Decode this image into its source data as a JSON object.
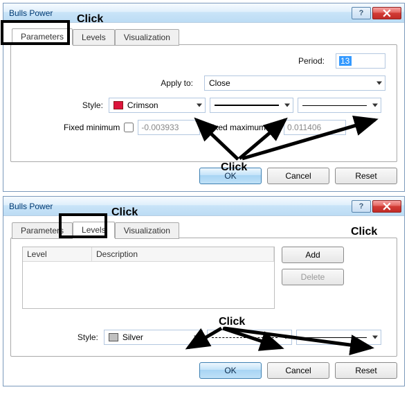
{
  "top": {
    "title": "Bulls Power",
    "tabs": {
      "parameters": "Parameters",
      "levels": "Levels",
      "visualization": "Visualization"
    },
    "period_label": "Period:",
    "period_value": "13",
    "apply_label": "Apply to:",
    "apply_value": "Close",
    "style_label": "Style:",
    "style_color_name": "Crimson",
    "fixed_min_label": "Fixed minimum",
    "fixed_min_value": "-0.003933",
    "fixed_max_label": "Fixed maximum",
    "fixed_max_value": "0.011406",
    "buttons": {
      "ok": "OK",
      "cancel": "Cancel",
      "reset": "Reset"
    }
  },
  "bottom": {
    "title": "Bulls Power",
    "tabs": {
      "parameters": "Parameters",
      "levels": "Levels",
      "visualization": "Visualization"
    },
    "table": {
      "col_level": "Level",
      "col_desc": "Description"
    },
    "add": "Add",
    "delete": "Delete",
    "style_label": "Style:",
    "style_color_name": "Silver",
    "buttons": {
      "ok": "OK",
      "cancel": "Cancel",
      "reset": "Reset"
    }
  },
  "annotations": {
    "click": "Click"
  }
}
